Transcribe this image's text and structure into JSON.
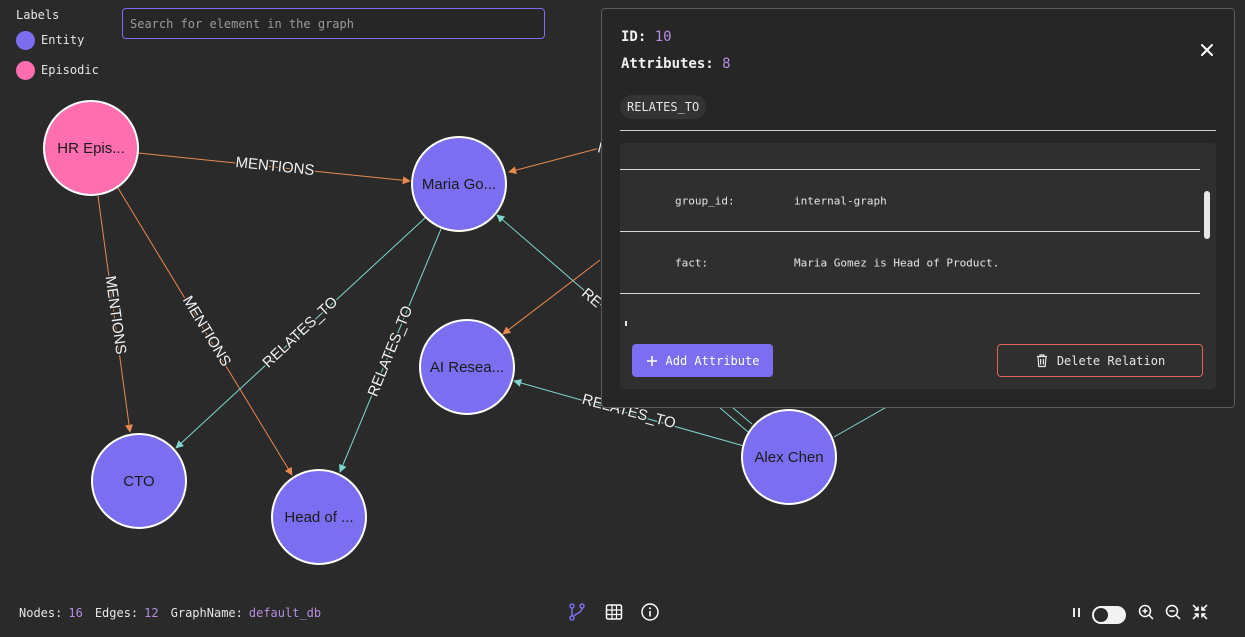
{
  "legend": {
    "title": "Labels",
    "items": [
      {
        "label": "Entity",
        "color": "#7b6ef0"
      },
      {
        "label": "Episodic",
        "color": "#ff6fb0"
      }
    ]
  },
  "search": {
    "placeholder": "Search for element in the graph"
  },
  "graph": {
    "nodes": [
      {
        "label": "HR Epis...",
        "type": "Episodic"
      },
      {
        "label": "Maria Go...",
        "type": "Entity"
      },
      {
        "label": "AI Resea...",
        "type": "Entity"
      },
      {
        "label": "CTO",
        "type": "Entity"
      },
      {
        "label": "Head of ...",
        "type": "Entity"
      },
      {
        "label": "Alex Chen",
        "type": "Entity"
      }
    ],
    "edge_labels": {
      "mentions": "MENTIONS",
      "relates_to": "RELATES_TO",
      "partial_m": "M",
      "partial_re": "RE"
    }
  },
  "panel": {
    "id_label": "ID:",
    "id_value": "10",
    "attributes_label": "Attributes:",
    "attributes_value": "8",
    "relation_type": "RELATES_TO",
    "attributes": [
      {
        "key": "group_id:",
        "value": "internal-graph"
      },
      {
        "key": "fact:",
        "value": "Maria Gomez is Head of Product."
      }
    ],
    "add_attribute_label": "Add Attribute",
    "delete_relation_label": "Delete Relation"
  },
  "footer": {
    "nodes_label": "Nodes:",
    "nodes_value": "16",
    "edges_label": "Edges:",
    "edges_value": "12",
    "graphname_label": "GraphName:",
    "graphname_value": "default_db"
  },
  "icons": {
    "graph_view": "graph-view-icon",
    "table_view": "table-icon",
    "info": "info-icon",
    "pause": "pause-icon",
    "zoom_in": "zoom-in-icon",
    "zoom_out": "zoom-out-icon",
    "fit": "fit-screen-icon"
  },
  "colors": {
    "entity": "#7b6ef0",
    "episodic": "#ff6fb0",
    "mentions_edge": "#e8894f",
    "relates_edge": "#7fd6cf",
    "accent": "#b68de0",
    "danger": "#e0605a"
  }
}
